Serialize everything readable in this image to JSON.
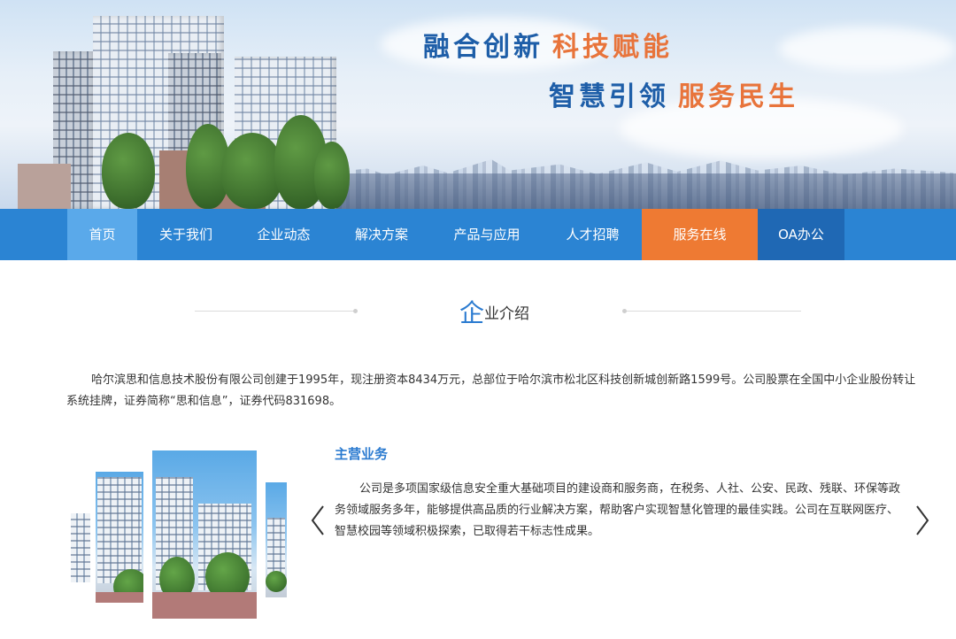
{
  "banner": {
    "slogan_line1_blue": "融合创新",
    "slogan_line1_orange": "科技赋能",
    "slogan_line2_blue": "智慧引领",
    "slogan_line2_orange": "服务民生"
  },
  "nav": {
    "items": [
      {
        "label": "首页",
        "state": "active"
      },
      {
        "label": "关于我们"
      },
      {
        "label": "企业动态"
      },
      {
        "label": "解决方案"
      },
      {
        "label": "产品与应用"
      },
      {
        "label": "人才招聘"
      },
      {
        "label": "服务在线",
        "state": "highlight"
      },
      {
        "label": "OA办公"
      }
    ]
  },
  "section": {
    "title_first_char": "企",
    "title_rest": "业介绍"
  },
  "intro": {
    "text": "哈尔滨思和信息技术股份有限公司创建于1995年，现注册资本8434万元，总部位于哈尔滨市松北区科技创新城创新路1599号。公司股票在全国中小企业股份转让系统挂牌，证券简称“思和信息”，证券代码831698。"
  },
  "business": {
    "title": "主营业务",
    "text": "公司是多项国家级信息安全重大基础项目的建设商和服务商，在税务、人社、公安、民政、残联、环保等政务领域服务多年，能够提供高品质的行业解决方案，帮助客户实现智慧化管理的最佳实践。公司在互联网医疗、智慧校园等领域积极探索，已取得若干标志性成果。"
  },
  "colors": {
    "nav_bg": "#2b84d3",
    "nav_active": "#5aa9ea",
    "nav_service": "#ee7a33",
    "nav_oa": "#1f68b4",
    "accent_blue": "#2b7bd0",
    "accent_orange": "#e8743b"
  },
  "icons": {
    "prev": "chevron-left-icon",
    "next": "chevron-right-icon"
  }
}
